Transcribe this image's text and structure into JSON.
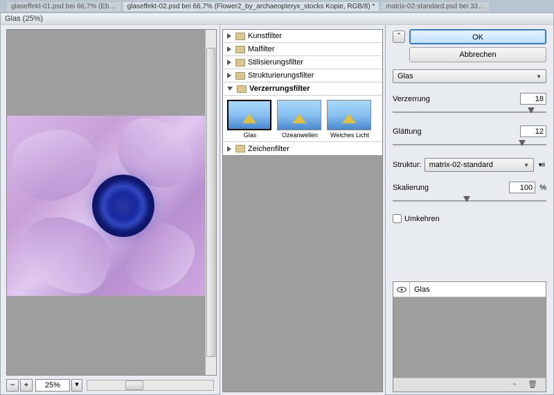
{
  "tabs": {
    "t1": "glaseffekt-01.psd bei 66,7% (Eb…",
    "t2": "glaseffekt-02.psd bei 66,7% (Flower2_by_archaeopteryx_stocks Kopie, RGB/8) *",
    "t3": "matrix-02-standard.psd bei 33…"
  },
  "dialog": {
    "title": "Glas (25%)",
    "zoom": "25%"
  },
  "categories": {
    "kunst": "Kunstfilter",
    "mal": "Malfilter",
    "stil": "Stilisierungsfilter",
    "strukt": "Strukturierungsfilter",
    "verzerr": "Verzerrungsfilter",
    "zeichen": "Zeichenfilter"
  },
  "thumbs": {
    "glas": "Glas",
    "ozean": "Ozeanwellen",
    "weich": "Weiches Licht"
  },
  "buttons": {
    "ok": "OK",
    "cancel": "Abbrechen"
  },
  "filter_dropdown": "Glas",
  "sliders": {
    "verzerrung": {
      "label": "Verzerrung",
      "value": "18",
      "pos": 88
    },
    "glaettung": {
      "label": "Glättung",
      "value": "12",
      "pos": 82
    },
    "skalierung": {
      "label": "Skalierung",
      "value": "100",
      "pos": 46,
      "suffix": "%"
    }
  },
  "struktur": {
    "label": "Struktur:",
    "value": "matrix-02-standard"
  },
  "umkehren": "Umkehren",
  "layer": {
    "name": "Glas"
  }
}
